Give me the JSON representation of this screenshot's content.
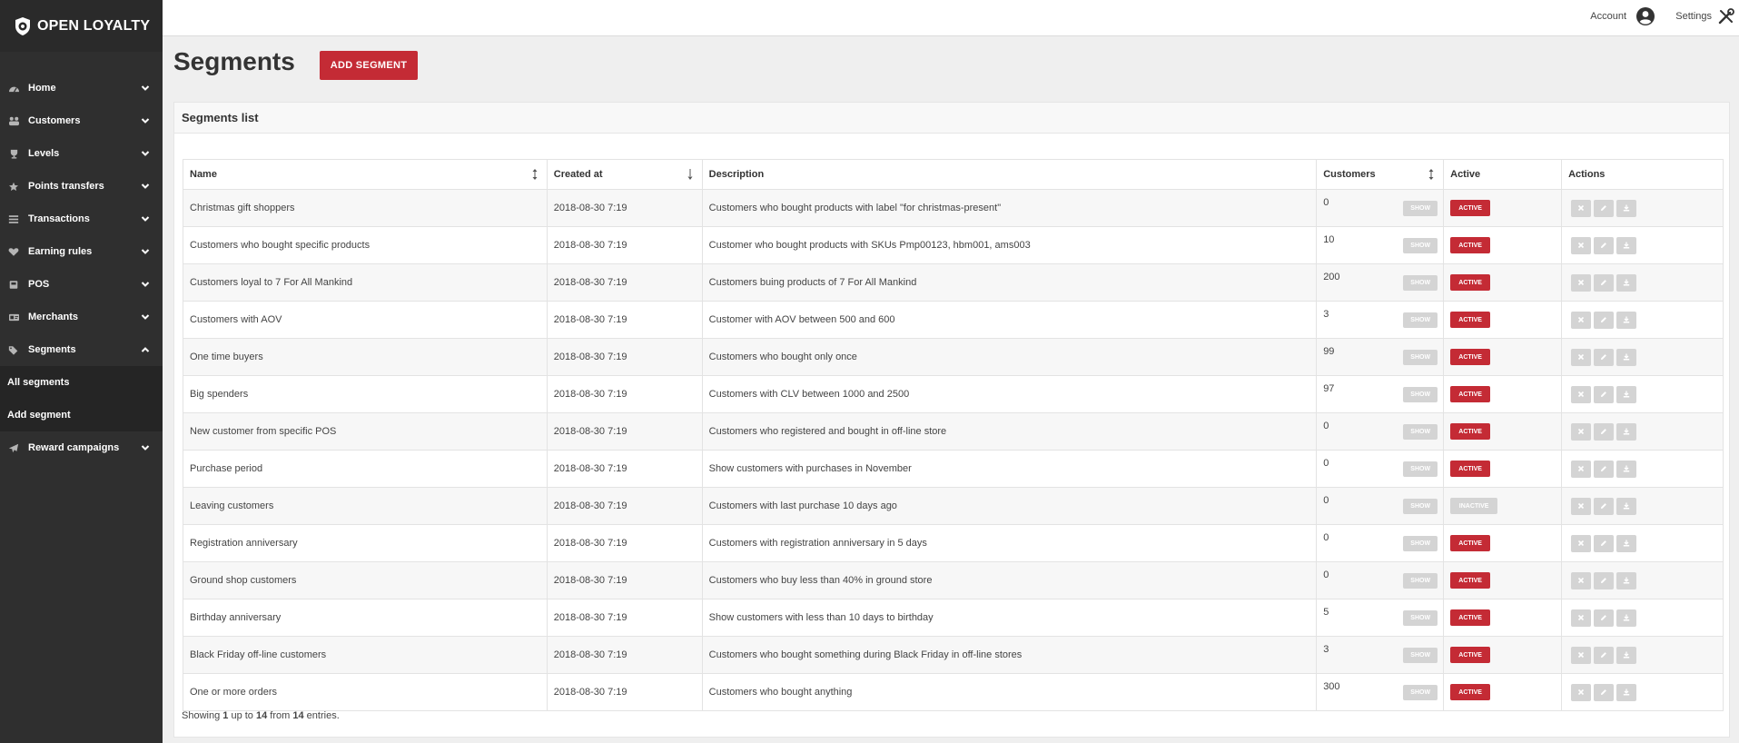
{
  "brand": "OPEN LOYALTY",
  "topbar": {
    "account": "Account",
    "settings": "Settings"
  },
  "sidebar": {
    "items": [
      {
        "label": "Home",
        "icon": "dashboard-icon"
      },
      {
        "label": "Customers",
        "icon": "users-icon"
      },
      {
        "label": "Levels",
        "icon": "trophy-icon"
      },
      {
        "label": "Points transfers",
        "icon": "star-icon"
      },
      {
        "label": "Transactions",
        "icon": "list-icon"
      },
      {
        "label": "Earning rules",
        "icon": "heart-icon"
      },
      {
        "label": "POS",
        "icon": "pos-icon"
      },
      {
        "label": "Merchants",
        "icon": "merchant-icon"
      },
      {
        "label": "Segments",
        "icon": "tags-icon",
        "expanded": true
      },
      {
        "label": "Reward campaigns",
        "icon": "paper-plane-icon"
      }
    ],
    "sub_items": [
      "All segments",
      "Add segment"
    ]
  },
  "page": {
    "title": "Segments",
    "add_button": "ADD SEGMENT",
    "panel_title": "Segments list"
  },
  "table": {
    "headers": [
      "Name",
      "Created at",
      "Description",
      "Customers",
      "Active",
      "Actions"
    ],
    "show_label": "SHOW",
    "active_label": "ACTIVE",
    "inactive_label": "INACTIVE",
    "rows": [
      {
        "name": "Christmas gift shoppers",
        "created": "2018-08-30 7:19",
        "desc": "Customers who bought products with label \"for christmas-present\"",
        "customers": "0",
        "active": true
      },
      {
        "name": "Customers who bought specific products",
        "created": "2018-08-30 7:19",
        "desc": "Customer who bought products with SKUs Pmp00123, hbm001, ams003",
        "customers": "10",
        "active": true
      },
      {
        "name": "Customers loyal to 7 For All Mankind",
        "created": "2018-08-30 7:19",
        "desc": "Customers buing products of 7 For All Mankind",
        "customers": "200",
        "active": true
      },
      {
        "name": "Customers with AOV",
        "created": "2018-08-30 7:19",
        "desc": "Customer with AOV between 500 and 600",
        "customers": "3",
        "active": true
      },
      {
        "name": "One time buyers",
        "created": "2018-08-30 7:19",
        "desc": "Customers who bought only once",
        "customers": "99",
        "active": true
      },
      {
        "name": "Big spenders",
        "created": "2018-08-30 7:19",
        "desc": "Customers with CLV between 1000 and 2500",
        "customers": "97",
        "active": true
      },
      {
        "name": "New customer from specific POS",
        "created": "2018-08-30 7:19",
        "desc": "Customers who registered and bought in off-line store",
        "customers": "0",
        "active": true
      },
      {
        "name": "Purchase period",
        "created": "2018-08-30 7:19",
        "desc": "Show customers with purchases in November",
        "customers": "0",
        "active": true
      },
      {
        "name": "Leaving customers",
        "created": "2018-08-30 7:19",
        "desc": "Customers with last purchase 10 days ago",
        "customers": "0",
        "active": false
      },
      {
        "name": "Registration anniversary",
        "created": "2018-08-30 7:19",
        "desc": "Customers with registration anniversary in 5 days",
        "customers": "0",
        "active": true
      },
      {
        "name": "Ground shop customers",
        "created": "2018-08-30 7:19",
        "desc": "Customers who buy less than 40% in ground store",
        "customers": "0",
        "active": true
      },
      {
        "name": "Birthday anniversary",
        "created": "2018-08-30 7:19",
        "desc": "Show customers with less than 10 days to birthday",
        "customers": "5",
        "active": true
      },
      {
        "name": "Black Friday off-line customers",
        "created": "2018-08-30 7:19",
        "desc": "Customers who bought something during Black Friday in off-line stores",
        "customers": "3",
        "active": true
      },
      {
        "name": "One or more orders",
        "created": "2018-08-30 7:19",
        "desc": "Customers who bought anything",
        "customers": "300",
        "active": true
      }
    ]
  },
  "footer": {
    "showing": "Showing",
    "from_word": "1",
    "up_to": "up to",
    "to_word": "14",
    "from": "from",
    "total": "14",
    "entries": "entries."
  },
  "colors": {
    "accent": "#c42b35",
    "sidebar": "#2f2f2f",
    "muted_button": "#d4d4d4"
  }
}
